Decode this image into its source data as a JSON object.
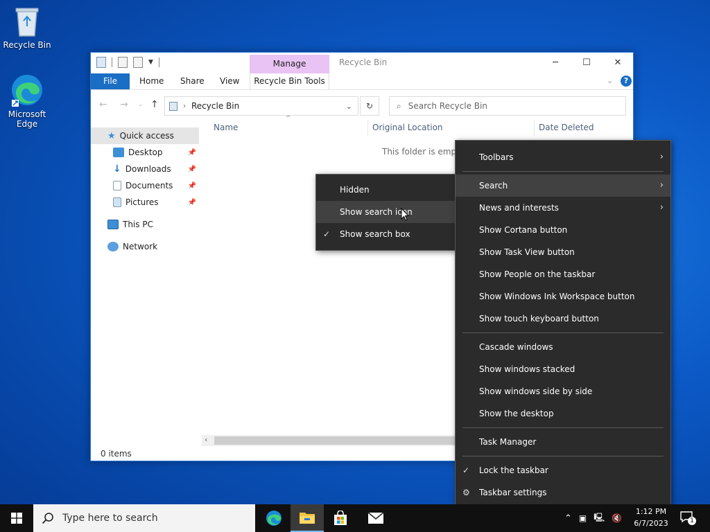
{
  "desktop": {
    "icons": [
      {
        "label": "Recycle Bin"
      },
      {
        "label": "Microsoft Edge"
      }
    ]
  },
  "explorer": {
    "context_tab": "Manage",
    "title": "Recycle Bin",
    "ribbon_tabs": [
      "File",
      "Home",
      "Share",
      "View",
      "Recycle Bin Tools"
    ],
    "address_path": "Recycle Bin",
    "search_placeholder": "Search Recycle Bin",
    "nav": {
      "quick_access": "Quick access",
      "desktop": "Desktop",
      "downloads": "Downloads",
      "documents": "Documents",
      "pictures": "Pictures",
      "this_pc": "This PC",
      "network": "Network"
    },
    "columns": [
      "Name",
      "Original Location",
      "Date Deleted"
    ],
    "empty_message": "This folder is empty.",
    "status": "0 items"
  },
  "submenu": {
    "items": [
      "Hidden",
      "Show search icon",
      "Show search box"
    ]
  },
  "taskbar_menu": {
    "items": [
      "Toolbars",
      "Search",
      "News and interests",
      "Show Cortana button",
      "Show Task View button",
      "Show People on the taskbar",
      "Show Windows Ink Workspace button",
      "Show touch keyboard button",
      "Cascade windows",
      "Show windows stacked",
      "Show windows side by side",
      "Show the desktop",
      "Task Manager",
      "Lock the taskbar",
      "Taskbar settings"
    ]
  },
  "taskbar": {
    "search_placeholder": "Type here to search",
    "time": "1:12 PM",
    "date": "6/7/2023",
    "notification_count": "1"
  },
  "colors": {
    "accent": "#1a6ec4",
    "manage_tab": "#e9c3f3",
    "menu_bg": "#2b2b2b",
    "taskbar_bg": "#101010"
  }
}
